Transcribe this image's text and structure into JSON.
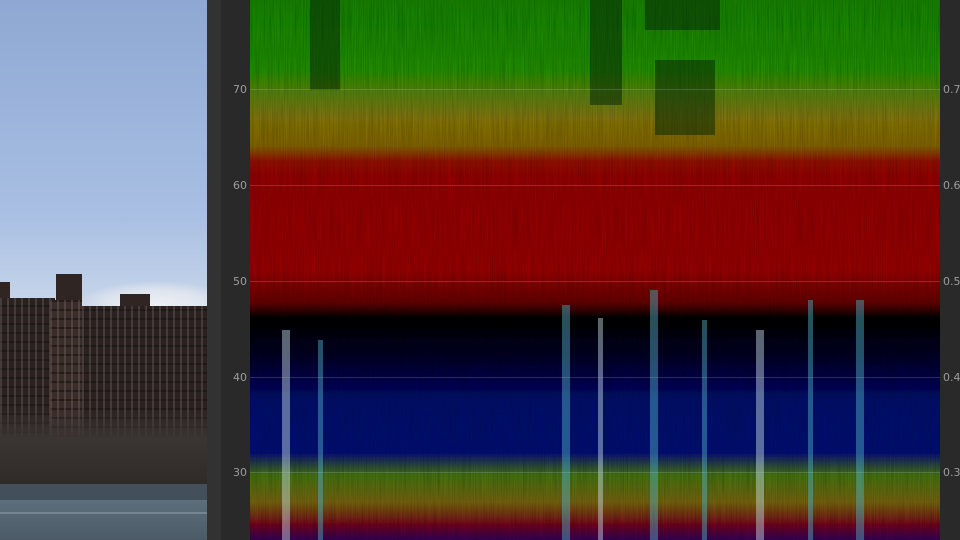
{
  "scope": {
    "left_axis_labels": [
      "70",
      "60",
      "50",
      "40",
      "30"
    ],
    "right_axis_labels": [
      "0.7",
      "0.6",
      "0.5",
      "0.4",
      "0.3"
    ],
    "colors": {
      "green": "#1f8a0c",
      "yellow": "#8a7d10",
      "red": "#9b0b0b",
      "black": "#050508",
      "blue": "#0d1470",
      "cyan": "#4fb3c8",
      "grid": "#c8c8c8",
      "label": "#9c9c9c"
    }
  },
  "video_preview": {
    "colors": {
      "sky": "#9db6df",
      "buildings": "#2f2523",
      "water": "#566875"
    }
  }
}
